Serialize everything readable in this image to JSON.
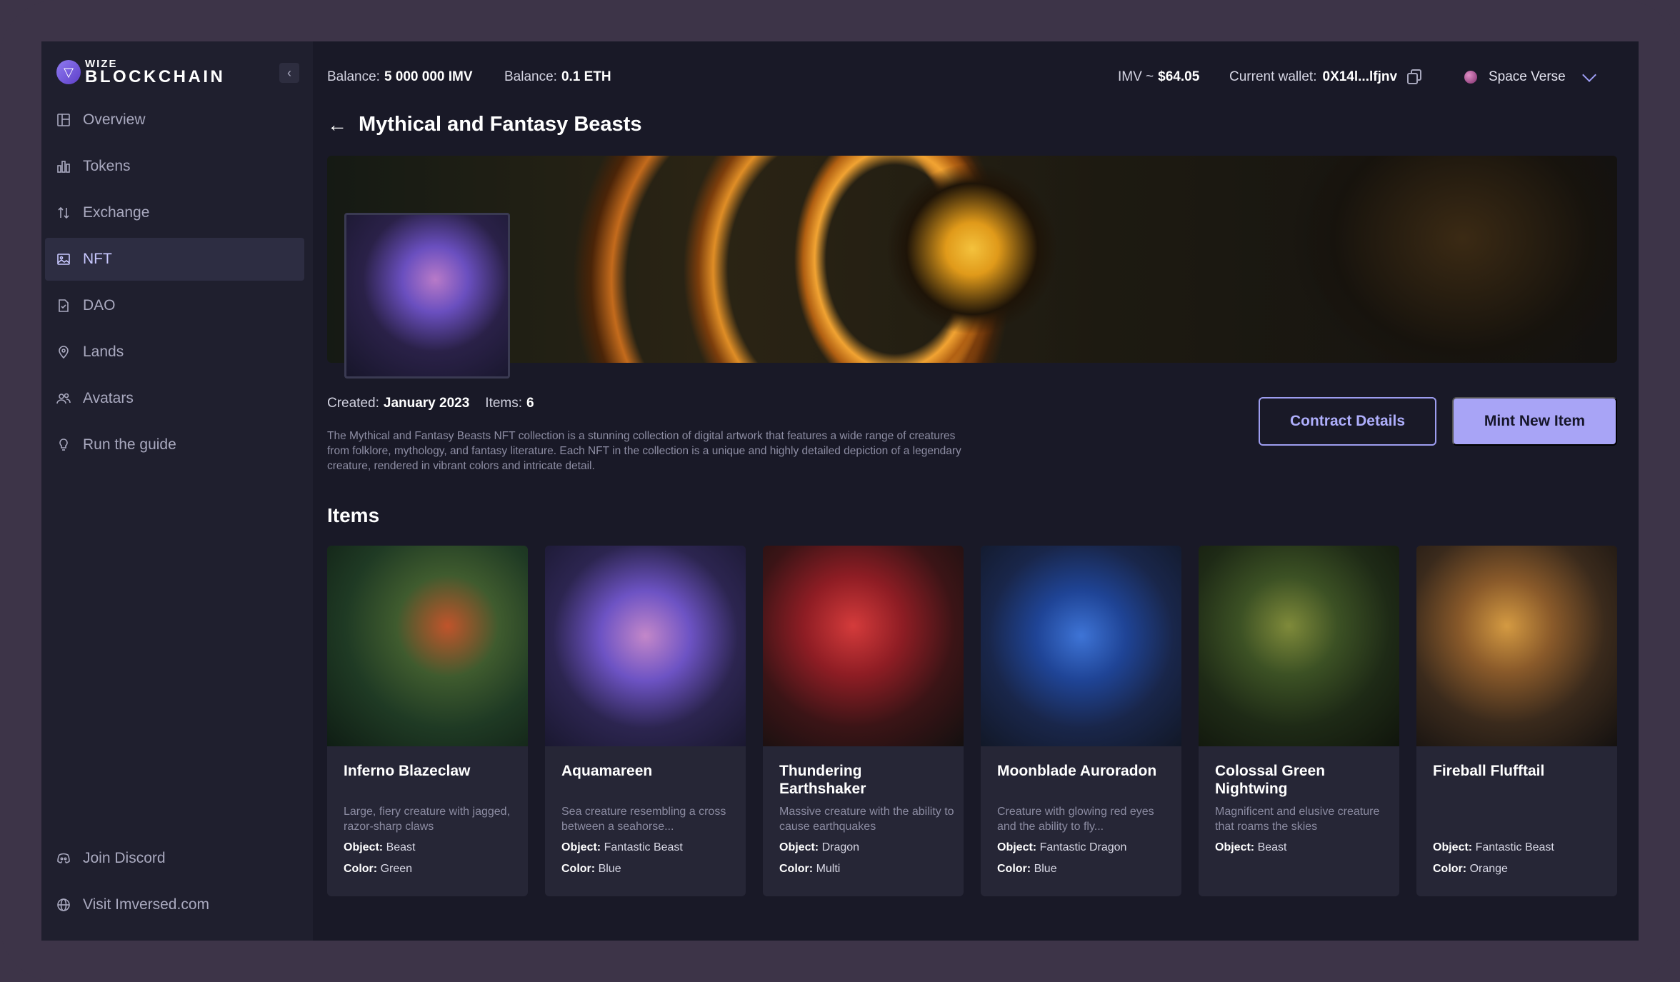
{
  "brand": {
    "logo_small": "WIZE",
    "logo_big": "BLOCKCHAIN"
  },
  "sidebar": {
    "items": [
      {
        "label": "Overview",
        "icon": "overview-icon",
        "active": false
      },
      {
        "label": "Tokens",
        "icon": "tokens-icon",
        "active": false
      },
      {
        "label": "Exchange",
        "icon": "exchange-icon",
        "active": false
      },
      {
        "label": "NFT",
        "icon": "image-icon",
        "active": true
      },
      {
        "label": "DAO",
        "icon": "document-icon",
        "active": false
      },
      {
        "label": "Lands",
        "icon": "location-pin-icon",
        "active": false
      },
      {
        "label": "Avatars",
        "icon": "users-icon",
        "active": false
      },
      {
        "label": "Run the guide",
        "icon": "lightbulb-icon",
        "active": false
      }
    ],
    "bottom": [
      {
        "label": "Join Discord",
        "icon": "discord-icon"
      },
      {
        "label": "Visit Imversed.com",
        "icon": "globe-icon"
      }
    ]
  },
  "topbar": {
    "balance1_label": "Balance:",
    "balance1_value": "5 000 000 IMV",
    "balance2_label": "Balance:",
    "balance2_value": "0.1 ETH",
    "imv_label": "IMV ~",
    "imv_value": "$64.05",
    "wallet_label": "Current wallet:",
    "wallet_value": "0X14l...lfjnv",
    "space_label": "Space Verse"
  },
  "collection": {
    "title": "Mythical and Fantasy Beasts",
    "created_label": "Created:",
    "created_value": "January 2023",
    "items_label": "Items:",
    "items_value": "6",
    "description": "The Mythical and Fantasy Beasts NFT collection is a stunning collection of digital artwork that features a wide range of creatures from folklore, mythology, and fantasy literature. Each NFT in the collection is a unique and highly detailed depiction of a legendary creature, rendered in vibrant colors and intricate detail.",
    "contract_button": "Contract Details",
    "mint_button": "Mint New Item"
  },
  "items_title": "Items",
  "object_label": "Object:",
  "color_label": "Color:",
  "cards": [
    {
      "name": "Inferno Blazeclaw",
      "desc": "Large, fiery creature with jagged, razor-sharp claws",
      "object": "Beast",
      "color": "Green"
    },
    {
      "name": "Aquamareen",
      "desc": "Sea creature resembling a cross between a seahorse...",
      "object": "Fantastic Beast",
      "color": "Blue"
    },
    {
      "name": "Thundering Earthshaker",
      "desc": "Massive creature with the ability to cause earthquakes",
      "object": "Dragon",
      "color": "Multi"
    },
    {
      "name": "Moonblade Auroradon",
      "desc": "Creature with glowing red eyes and the ability to fly...",
      "object": "Fantastic Dragon",
      "color": "Blue"
    },
    {
      "name": "Colossal Green Nightwing",
      "desc": "Magnificent and elusive creature that roams the skies",
      "object": "Beast",
      "color": ""
    },
    {
      "name": "Fireball Flufftail",
      "desc": "",
      "object": "Fantastic Beast",
      "color": "Orange"
    }
  ]
}
